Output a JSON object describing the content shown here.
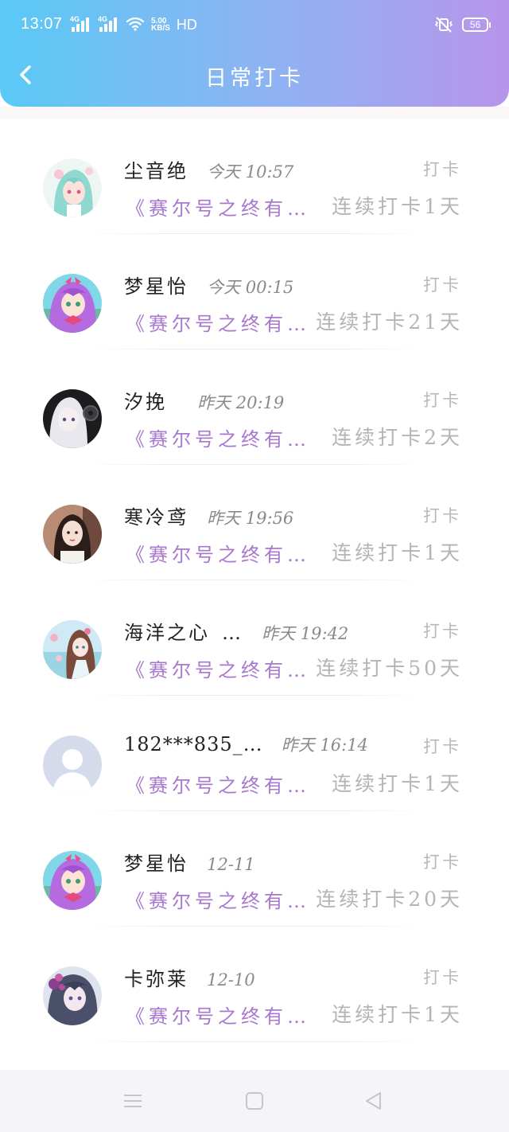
{
  "status_bar": {
    "time": "13:07",
    "signal_net_1": "4G",
    "signal_net_2": "4G",
    "speed_value": "5.00",
    "speed_unit": "KB/S",
    "hd": "HD",
    "battery": "56"
  },
  "header": {
    "title": "日常打卡",
    "gradient_colors": [
      "#59c9f5",
      "#90b2f2",
      "#b795ea"
    ]
  },
  "list": [
    {
      "name": "尘音绝",
      "time": "今天 10:57",
      "action": "打卡",
      "book": "《赛尔号之终有…",
      "streak": "连续打卡1天",
      "avatar": "anime-girl-teal-hair-icon"
    },
    {
      "name": "梦星怡",
      "time": "今天 00:15",
      "action": "打卡",
      "book": "《赛尔号之终有…",
      "streak": "连续打卡21天",
      "avatar": "anime-girl-purple-hair-icon"
    },
    {
      "name": "汐挽_",
      "time": "昨天 20:19",
      "action": "打卡",
      "book": "《赛尔号之终有…",
      "streak": "连续打卡2天",
      "avatar": "anime-girl-white-hair-icon"
    },
    {
      "name": "寒冷鸢",
      "time": "昨天 19:56",
      "action": "打卡",
      "book": "《赛尔号之终有…",
      "streak": "连续打卡1天",
      "avatar": "photo-girl-icon"
    },
    {
      "name": "海洋之心_…",
      "time": "昨天 19:42",
      "action": "打卡",
      "book": "《赛尔号之终有…",
      "streak": "连续打卡50天",
      "avatar": "anime-girl-flowers-icon"
    },
    {
      "name": "182***835_…",
      "time": "昨天 16:14",
      "action": "打卡",
      "book": "《赛尔号之终有…",
      "streak": "连续打卡1天",
      "avatar": "default-user-icon"
    },
    {
      "name": "梦星怡",
      "time": "12-11",
      "action": "打卡",
      "book": "《赛尔号之终有…",
      "streak": "连续打卡20天",
      "avatar": "anime-girl-purple-hair-icon"
    },
    {
      "name": "卡弥莱",
      "time": "12-10",
      "action": "打卡",
      "book": "《赛尔号之终有…",
      "streak": "连续打卡1天",
      "avatar": "anime-girl-dark-hair-icon"
    }
  ],
  "colors": {
    "book_title": "#a878cf",
    "streak_text": "#b4b4b4",
    "time_text": "#8a8a8a"
  }
}
